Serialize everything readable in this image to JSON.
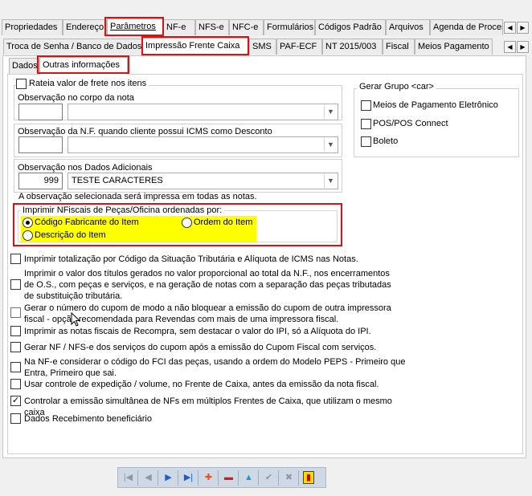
{
  "tabs_row1": [
    {
      "label": "Propriedades"
    },
    {
      "label": "Endereço"
    },
    {
      "label": "Parâmetros"
    },
    {
      "label": "NF-e"
    },
    {
      "label": "NFS-e"
    },
    {
      "label": "NFC-e"
    },
    {
      "label": "Formulários"
    },
    {
      "label": "Códigos Padrão"
    },
    {
      "label": "Arquivos"
    },
    {
      "label": "Agenda de Proces"
    }
  ],
  "tabs_row2": [
    {
      "label": "Troca de Senha / Banco de Dados"
    },
    {
      "label": "Impressão Frente Caixa"
    },
    {
      "label": "SMS"
    },
    {
      "label": "PAF-ECF"
    },
    {
      "label": "NT 2015/003"
    },
    {
      "label": "Fiscal"
    },
    {
      "label": "Meios Pagamento"
    }
  ],
  "tabs_row3": [
    {
      "label": "Dados"
    },
    {
      "label": "Outras informações"
    }
  ],
  "nav_arrows": {
    "left": "◀",
    "right": "▶"
  },
  "form": {
    "rateia_frete": {
      "label": "Rateia valor de frete nos itens",
      "checked": false
    },
    "obs_corpo": {
      "label": "Observação no corpo da nota",
      "code": "",
      "value": ""
    },
    "obs_icms": {
      "label": "Observação da N.F. quando cliente possui ICMS como Desconto",
      "code": "",
      "value": ""
    },
    "obs_adicionais": {
      "label": "Observação nos Dados Adicionais",
      "code": "999",
      "value": "TESTE CARACTERES"
    },
    "obs_note": "A observação selecionada será impressa em todas as notas."
  },
  "gerar_grupo": {
    "title": "Gerar Grupo <car>",
    "items": [
      {
        "label": "Meios de Pagamento Eletrônico",
        "checked": false
      },
      {
        "label": "POS/POS Connect",
        "checked": false
      },
      {
        "label": "Boleto",
        "checked": false
      }
    ]
  },
  "ordenacao": {
    "title": "Imprimir  NFiscais de Peças/Oficina ordenadas por:",
    "options": [
      {
        "label": "Código Fabricante do Item",
        "selected": true
      },
      {
        "label": "Ordem do Item",
        "selected": false
      },
      {
        "label": "Descrição do Item",
        "selected": false
      }
    ]
  },
  "options": [
    {
      "label": "Imprimir totalização por Código da Situação Tributária e Alíquota de ICMS nas Notas.",
      "checked": false
    },
    {
      "label": "Imprimir o valor dos títulos gerados no valor proporcional ao total da N.F., nos encerramentos de O.S., com peças e serviços, e na geração de notas com a separação das peças tributadas de substituição tributária.",
      "checked": false
    },
    {
      "label": "Gerar o número do cupom de modo a não bloquear a emissão do cupom de outra impressora fiscal - opção recomendada para Revendas com mais de uma impressora fiscal.",
      "checked": false
    },
    {
      "label": "Imprimir as notas fiscais de Recompra, sem destacar o valor do IPI, só a Alíquota do IPI.",
      "checked": false
    },
    {
      "label": "Gerar NF / NFS-e dos serviços do cupom após a emissão do Cupom Fiscal com serviços.",
      "checked": false
    },
    {
      "label": "Na NF-e considerar o código do FCI das peças, usando a ordem do Modelo PEPS - Primeiro que Entra, Primeiro que sai.",
      "checked": false
    },
    {
      "label": "Usar controle de expedição / volume, no Frente de Caixa, antes da emissão da nota fiscal.",
      "checked": false
    },
    {
      "label": "Controlar a emissão simultânea de NFs em múltiplos Frentes de Caixa, que utilizam o mesmo caixa",
      "checked": true
    },
    {
      "label": "Dados Recebimento beneficiário",
      "checked": false
    }
  ],
  "toolbar": {
    "first": "|◀",
    "prev": "◀",
    "next": "▶",
    "last": "▶|",
    "add": "✚",
    "remove": "▬",
    "edit": "▲",
    "confirm": "✔",
    "cancel": "✖",
    "exit": "▮"
  },
  "colors": {
    "highlight": "#ffff00",
    "red_box": "#e01010",
    "nav_blue": "#1a5fc8"
  }
}
